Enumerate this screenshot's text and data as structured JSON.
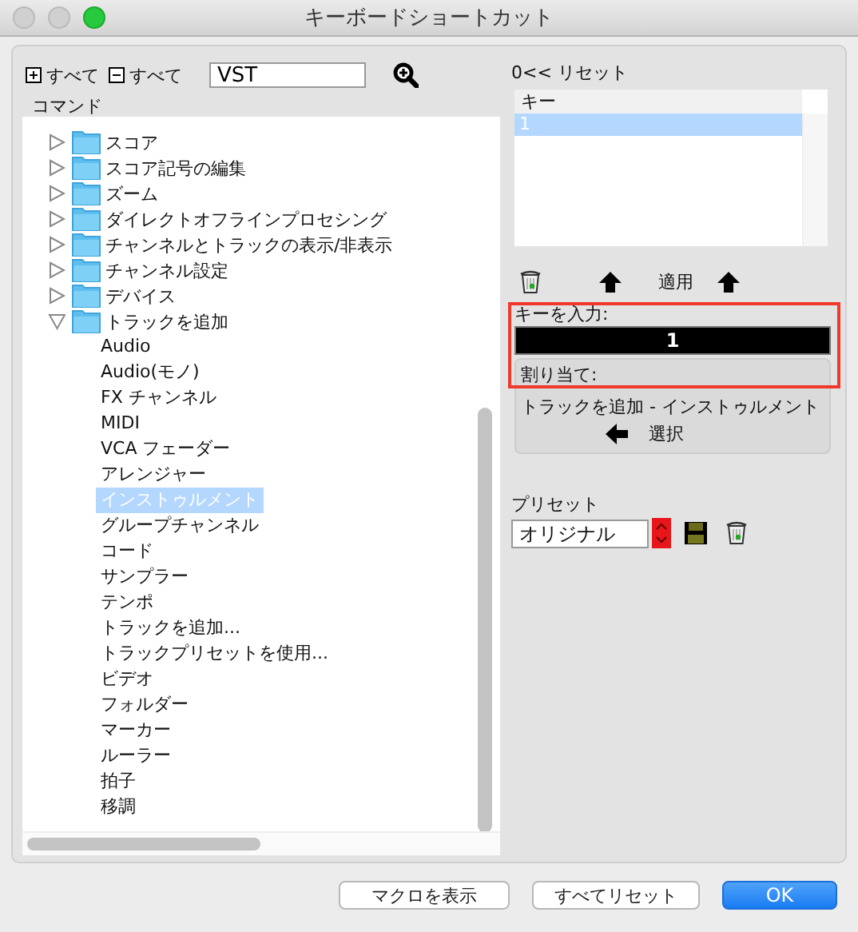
{
  "window": {
    "title": "キーボードショートカット"
  },
  "commands": {
    "expand_all": "すべて",
    "collapse_all": "すべて",
    "search": {
      "value": "VST"
    },
    "column": "コマンド",
    "tree": [
      {
        "label": "スコア",
        "expanded": false
      },
      {
        "label": "スコア記号の編集",
        "expanded": false
      },
      {
        "label": "ズーム",
        "expanded": false
      },
      {
        "label": "ダイレクトオフラインプロセシング",
        "expanded": false
      },
      {
        "label": "チャンネルとトラックの表示/非表示",
        "expanded": false
      },
      {
        "label": "チャンネル設定",
        "expanded": false
      },
      {
        "label": "デバイス",
        "expanded": false
      },
      {
        "label": "トラックを追加",
        "expanded": true,
        "children": [
          {
            "label": "Audio",
            "selected": false
          },
          {
            "label": "Audio(モノ)",
            "selected": false
          },
          {
            "label": "FX チャンネル",
            "selected": false
          },
          {
            "label": "MIDI",
            "selected": false
          },
          {
            "label": "VCA フェーダー",
            "selected": false
          },
          {
            "label": "アレンジャー",
            "selected": false
          },
          {
            "label": "インストゥルメント",
            "selected": true
          },
          {
            "label": "グループチャンネル",
            "selected": false
          },
          {
            "label": "コード",
            "selected": false
          },
          {
            "label": "サンプラー",
            "selected": false
          },
          {
            "label": "テンポ",
            "selected": false
          },
          {
            "label": "トラックを追加...",
            "selected": false
          },
          {
            "label": "トラックプリセットを使用...",
            "selected": false
          },
          {
            "label": "ビデオ",
            "selected": false
          },
          {
            "label": "フォルダー",
            "selected": false
          },
          {
            "label": "マーカー",
            "selected": false
          },
          {
            "label": "ルーラー",
            "selected": false
          },
          {
            "label": "拍子",
            "selected": false
          },
          {
            "label": "移調",
            "selected": false
          }
        ]
      }
    ]
  },
  "keys": {
    "reset": "0<< リセット",
    "column": "キー",
    "rows": [
      {
        "key": "1",
        "selected": true
      }
    ],
    "apply": "適用",
    "input_label": "キーを入力:",
    "input_value": "1",
    "assigned_label": "割り当て:",
    "assigned_to": "トラックを追加 - インストゥルメント",
    "select": "選択"
  },
  "preset": {
    "label": "プリセット",
    "value": "オリジナル"
  },
  "buttons": [
    {
      "label": "マクロを表示",
      "default": false
    },
    {
      "label": "すべてリセット",
      "default": false
    },
    {
      "label": "OK",
      "default": true
    }
  ]
}
